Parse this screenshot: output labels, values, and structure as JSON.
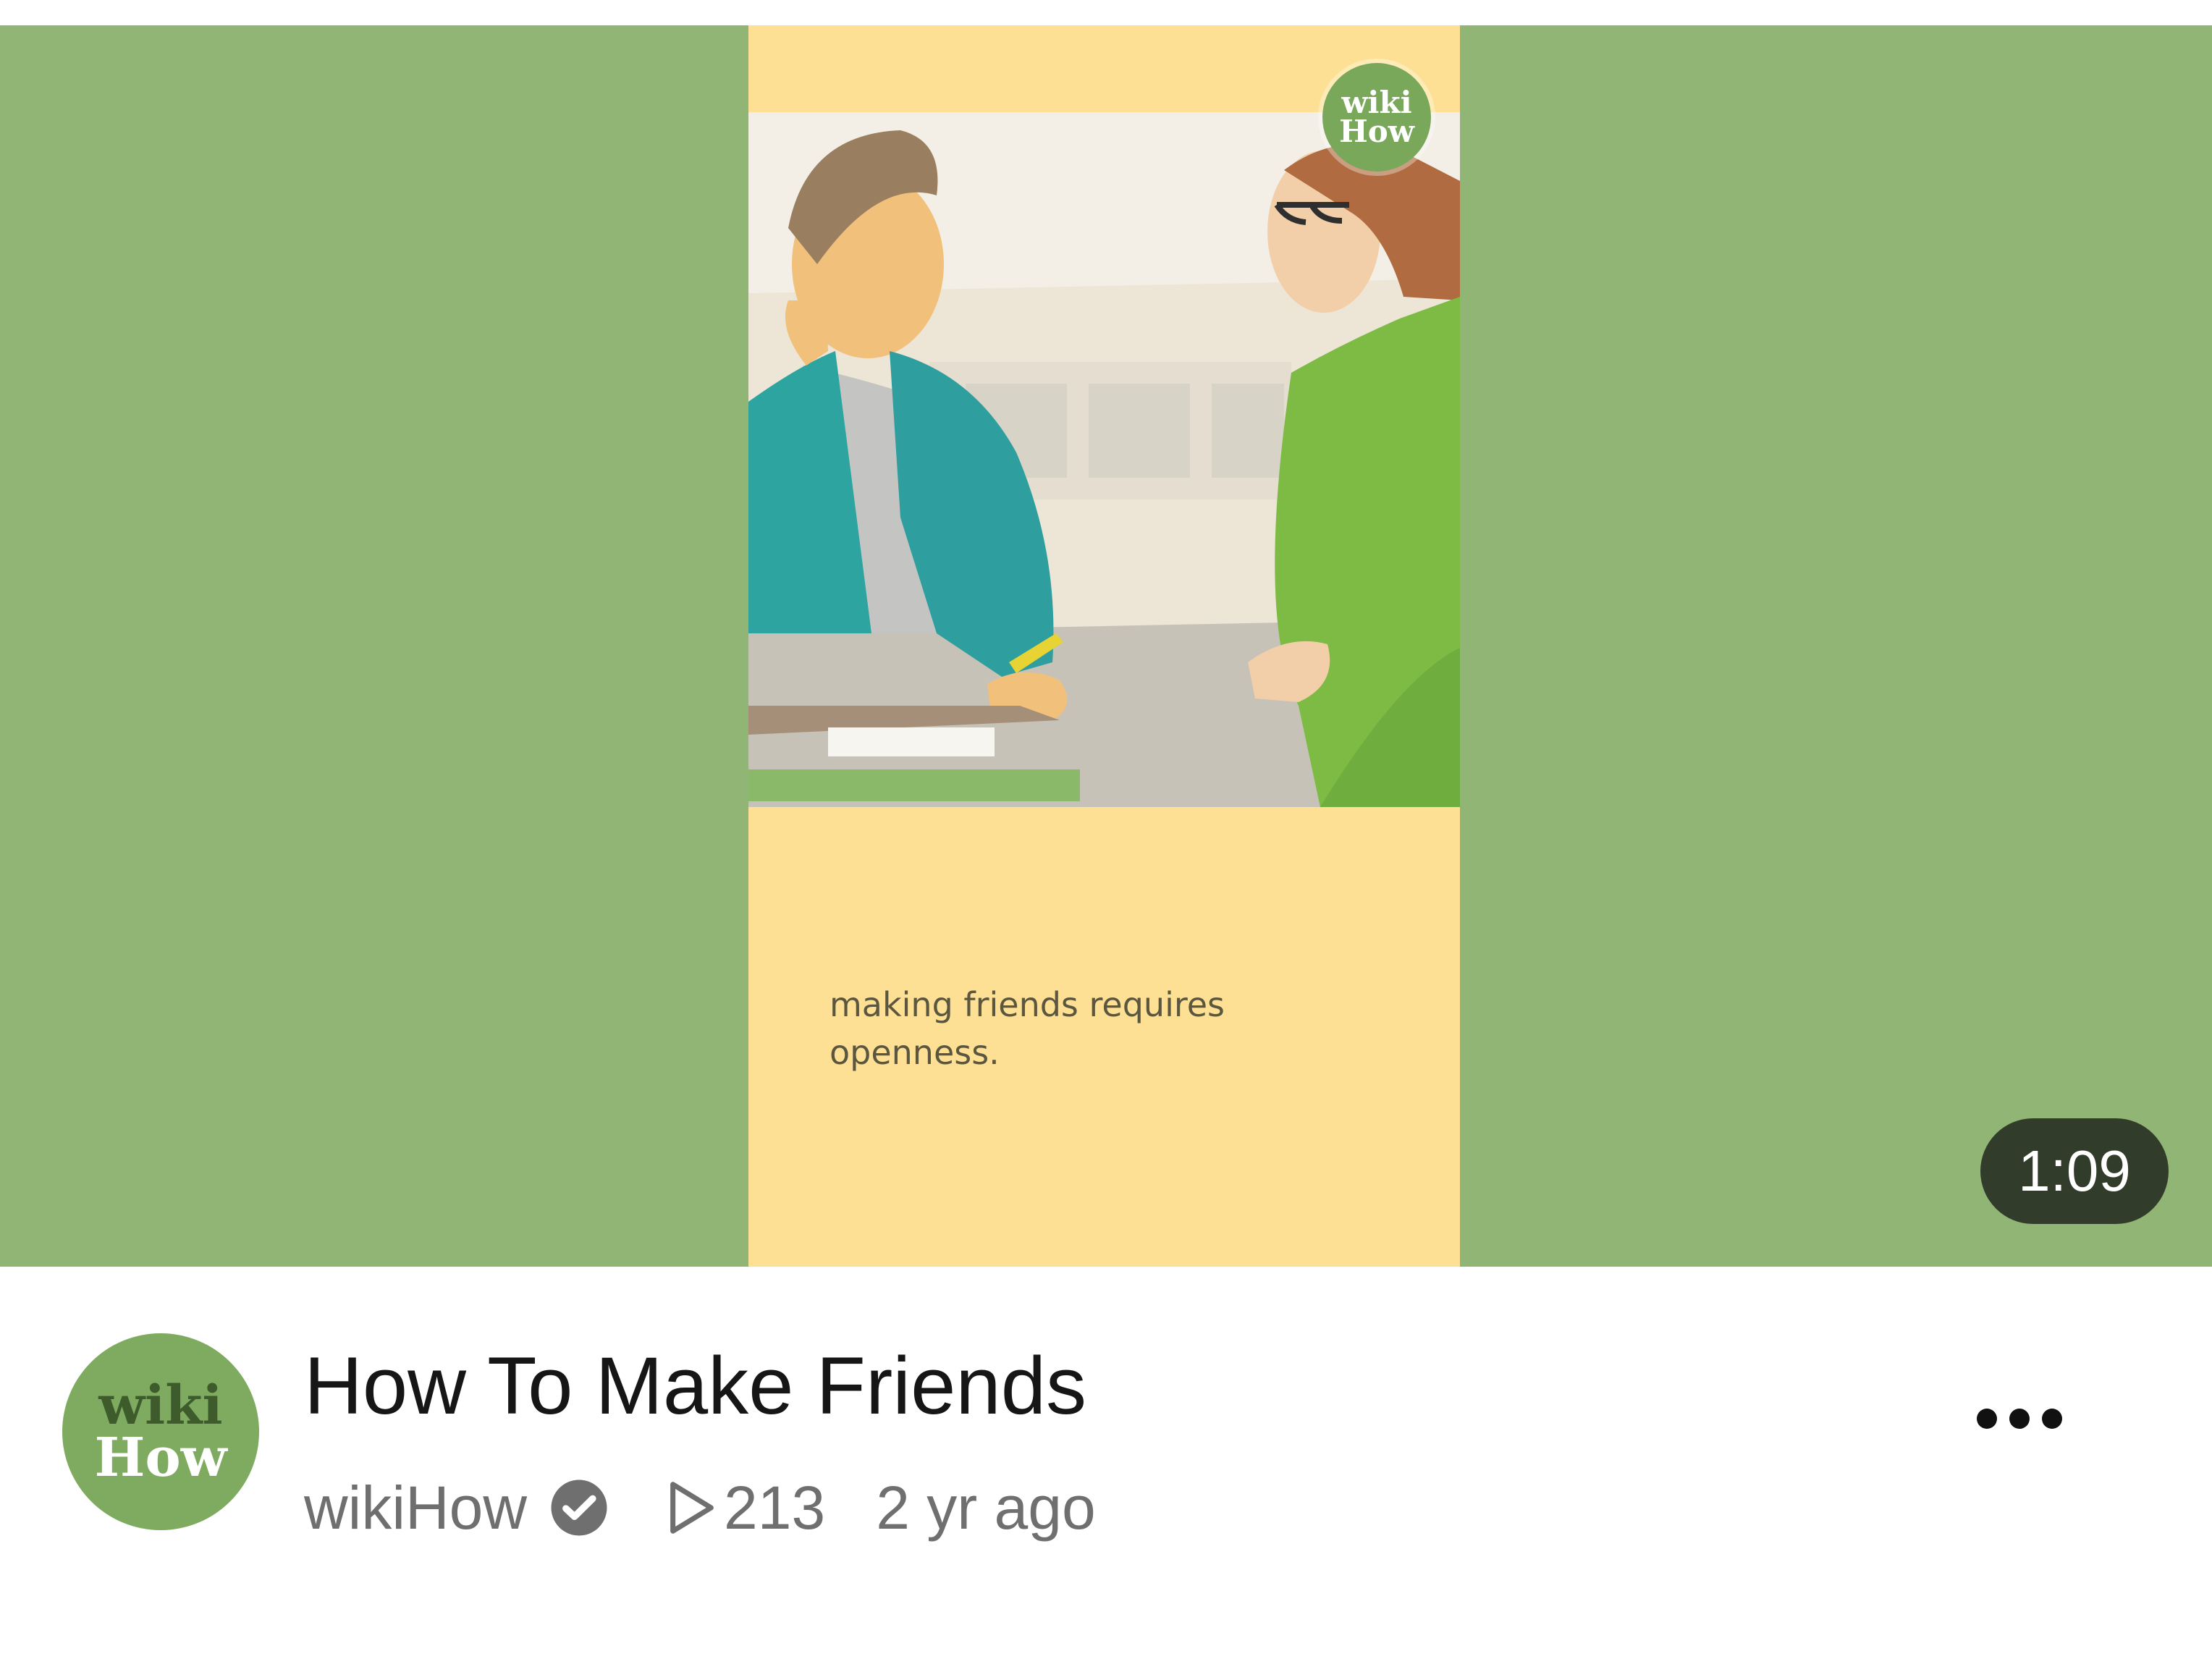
{
  "thumbnail": {
    "background_color": "#91b574",
    "poster_color": "#fde093",
    "logo_icon": "wikihow-logo",
    "logo_top": "wiki",
    "logo_bottom": "How",
    "caption": "making friends requires openness.",
    "duration": "1:09"
  },
  "video": {
    "title": "How To Make Friends",
    "channel": "wikiHow",
    "verified_icon": "verified-check-icon",
    "views_icon": "play-outline-icon",
    "views": "213",
    "age": "2 yr ago",
    "more_icon": "more-horizontal-icon"
  },
  "avatar": {
    "top": "wiki",
    "bottom": "How",
    "color": "#7eab60"
  }
}
